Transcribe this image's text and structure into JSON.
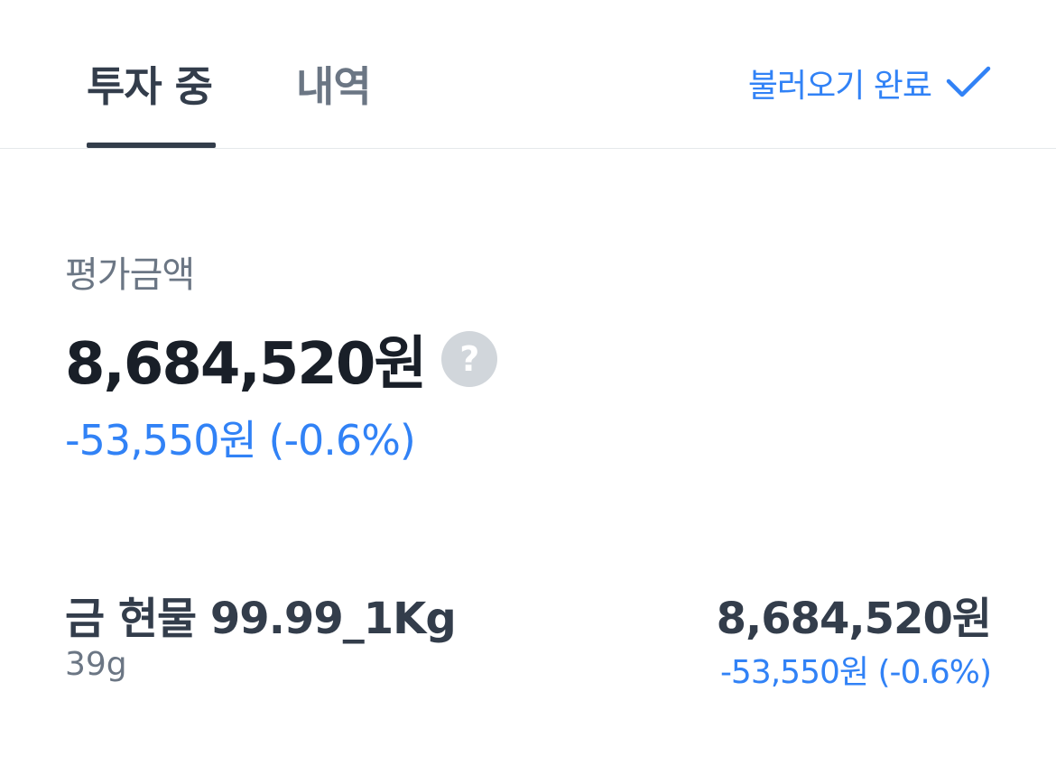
{
  "tabs": [
    {
      "label": "투자 중",
      "active": true
    },
    {
      "label": "내역",
      "active": false
    }
  ],
  "sync_status": {
    "label": "불러오기 완료",
    "icon": "checkmark-icon"
  },
  "summary": {
    "label": "평가금액",
    "total_amount": "8,684,520원",
    "help_icon_glyph": "?",
    "change": "-53,550원 (-0.6%)"
  },
  "holdings": [
    {
      "name": "금 현물 99.99_1Kg",
      "quantity": "39g",
      "value": "8,684,520원",
      "change": "-53,550원 (-0.6%)"
    }
  ],
  "colors": {
    "accent_blue": "#3182f6",
    "text_dark": "#191f28",
    "text_primary": "#333d4b",
    "text_secondary": "#6b7684",
    "help_icon_bg": "#d1d6db",
    "divider": "#e5e8eb"
  }
}
